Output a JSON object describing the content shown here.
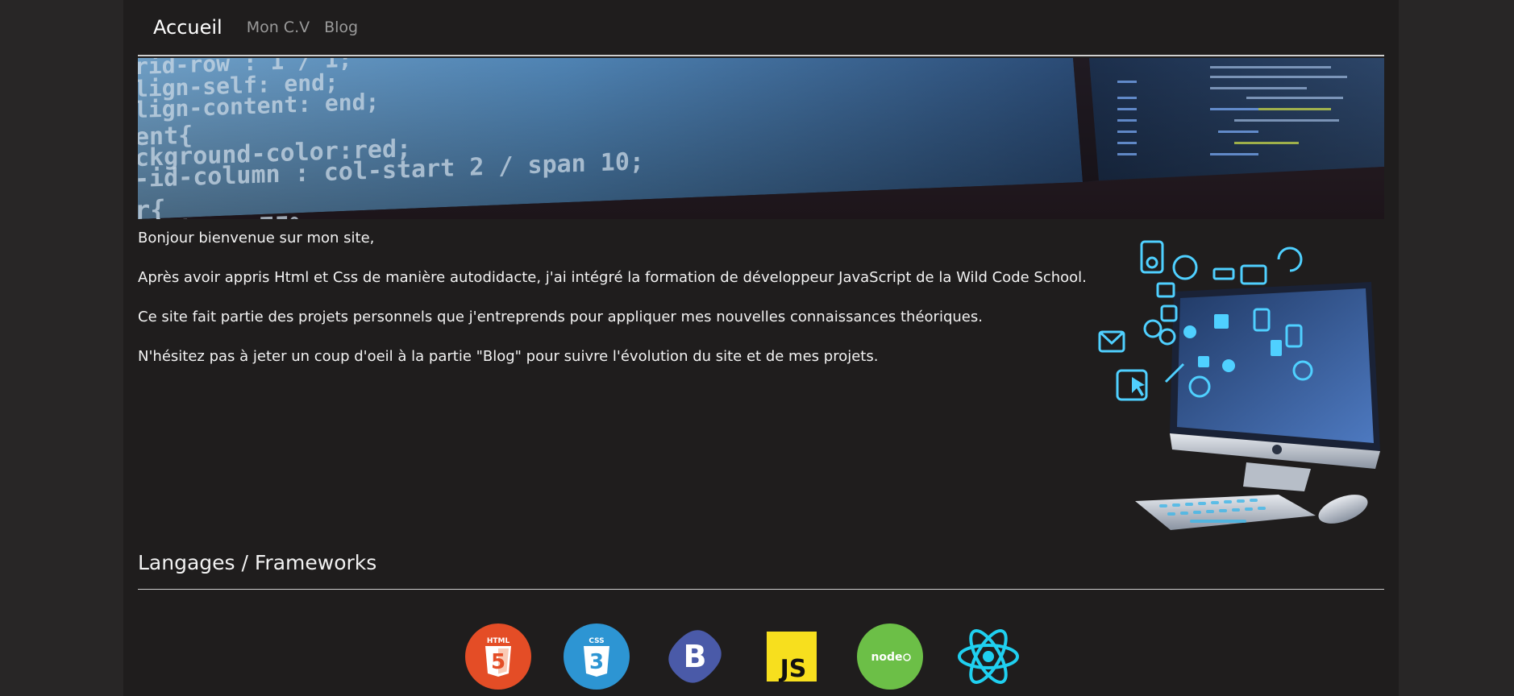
{
  "navbar": {
    "brand": "Accueil",
    "links": [
      "Mon C.V",
      "Blog"
    ]
  },
  "hero": {
    "code_lines_left": [
      "rid-row : 1 / 1;",
      "lign-self: end;",
      "lign-content: end;",
      "ent{",
      "ckground-color:red;",
      "-id-column : col-start 2 / span 10;",
      "r{",
      "eight : 75%;",
      "col-start 2 / span 10;",
      "-color:greenyellow;"
    ]
  },
  "intro": {
    "paragraphs": [
      "Bonjour bienvenue sur mon site,",
      "Après avoir appris Html et Css de manière autodidacte, j'ai intégré la formation de développeur JavaScript de la Wild Code School.",
      "Ce site fait partie des projets personnels que j'entreprends pour appliquer mes nouvelles connaissances théoriques.",
      "N'hésitez pas à jeter un coup d'oeil à la partie \"Blog\" pour suivre l'évolution du site et de mes projets."
    ]
  },
  "illustration": {
    "icon": "computer-with-app-icons-illustration"
  },
  "section": {
    "title": "Langages / Frameworks"
  },
  "technologies": [
    {
      "name": "HTML5",
      "badge": "HTML",
      "icon": "html5-logo-icon",
      "color": "#e44d26"
    },
    {
      "name": "CSS3",
      "badge": "CSS",
      "icon": "css3-logo-icon",
      "color": "#2d95d3"
    },
    {
      "name": "Bootstrap",
      "badge": "B",
      "icon": "bootstrap-logo-icon",
      "color": "#4a5aa8"
    },
    {
      "name": "JavaScript",
      "badge": "JS",
      "icon": "javascript-logo-icon",
      "color": "#f7df1e"
    },
    {
      "name": "Node.js",
      "badge": "node",
      "icon": "nodejs-logo-icon",
      "color": "#6cbf47"
    },
    {
      "name": "React",
      "badge": "",
      "icon": "react-logo-icon",
      "color": "#1fd0f0"
    }
  ],
  "colors": {
    "page_background": "#282626",
    "content_background": "#1f1d1d",
    "text": "#f2f2f2",
    "nav_link": "#9a9a9a",
    "rule": "#cfcfcf"
  }
}
